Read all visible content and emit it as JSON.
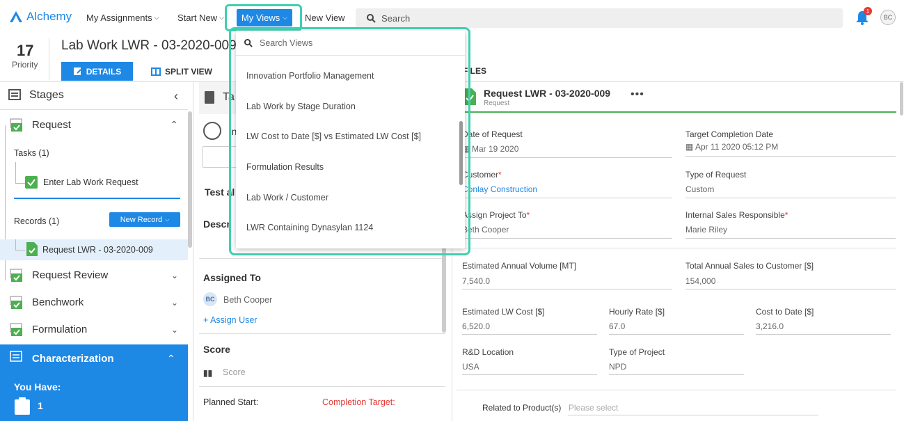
{
  "topnav": {
    "brand": "Alchemy",
    "my_assignments": "My Assignments",
    "start_new": "Start New",
    "my_views": "My Views",
    "new_view": "New View",
    "search_placeholder": "Search",
    "notification_count": "1",
    "user_initials": "BC"
  },
  "header": {
    "priority_value": "17",
    "priority_label": "Priority",
    "title": "Lab Work LWR - 03-2020-009",
    "tab_details": "DETAILS",
    "tab_split_view": "SPLIT VIEW",
    "tab_files": "FILES"
  },
  "sidebar": {
    "heading": "Stages",
    "request": "Request",
    "tasks": "Tasks (1)",
    "task_item": "Enter Lab Work Request",
    "records": "Records (1)",
    "new_record": "New Record",
    "record_item": "Request LWR - 03-2020-009",
    "request_review": "Request Review",
    "benchwork": "Benchwork",
    "formulation": "Formulation",
    "characterization": "Characterization",
    "you_have": "You Have:",
    "you_have_count": "1"
  },
  "middle": {
    "task_header": "Ta",
    "item_partial": "'n",
    "test_label": "Test al",
    "desc_label": "Descr",
    "assigned_to": "Assigned To",
    "assignee_initials": "BC",
    "assignee_name": "Beth Cooper",
    "assign_user": "+ Assign User",
    "score_label": "Score",
    "score_placeholder": "Score",
    "planned_start": "Planned Start:",
    "completion_target": "Completion Target:"
  },
  "record": {
    "title": "Request LWR - 03-2020-009",
    "subtitle": "Request",
    "date_of_request_label": "Date of Request",
    "date_of_request": "Mar 19 2020",
    "target_completion_label": "Target Completion Date",
    "target_completion": "Apr 11 2020 05:12 PM",
    "customer_label": "Customer",
    "customer": "Conlay Construction",
    "type_of_request_label": "Type of Request",
    "type_of_request": "Custom",
    "assign_project_label": "Assign Project To",
    "assign_project": "Beth Cooper",
    "internal_sales_label": "Internal Sales Responsible",
    "internal_sales": "Marie Riley",
    "annual_volume_label": "Estimated Annual Volume [MT]",
    "annual_volume": "7,540.0",
    "total_sales_label": "Total Annual Sales to Customer [$]",
    "total_sales": "154,000",
    "est_cost_label": "Estimated LW Cost [$]",
    "est_cost": "6,520.0",
    "hourly_rate_label": "Hourly Rate [$]",
    "hourly_rate": "67.0",
    "cost_to_date_label": "Cost to Date [$]",
    "cost_to_date": "3,216.0",
    "rd_location_label": "R&D Location",
    "rd_location": "USA",
    "type_project_label": "Type of Project",
    "type_project": "NPD",
    "related_products_label": "Related to Product(s)",
    "related_products_placeholder": "Please select",
    "required_mark": "*"
  },
  "views_dropdown": {
    "search_placeholder": "Search Views",
    "items": [
      "Innovation Portfolio Management",
      "Lab Work by Stage Duration",
      "LW Cost to Date [$] vs Estimated LW Cost [$]",
      "Formulation Results",
      "Lab Work / Customer",
      "LWR Containing Dynasylan 1124"
    ]
  },
  "colors": {
    "accent": "#1e88e5",
    "highlight": "#3fd0b0",
    "success": "#43a047",
    "required": "#e53935"
  }
}
